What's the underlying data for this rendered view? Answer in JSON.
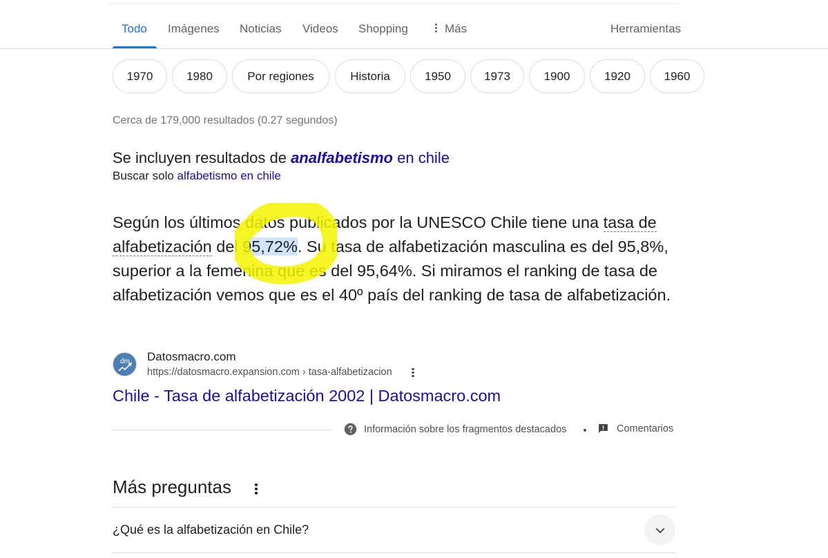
{
  "tabs": {
    "todo": "Todo",
    "imagenes": "Imágenes",
    "noticias": "Noticias",
    "videos": "Videos",
    "shopping": "Shopping",
    "mas": "Más",
    "herramientas": "Herramientas"
  },
  "chips": [
    "1970",
    "1980",
    "Por regiones",
    "Historia",
    "1950",
    "1973",
    "1900",
    "1920",
    "1960"
  ],
  "result_stats": "Cerca de 179,000 resultados (0.27 segundos)",
  "spelling": {
    "prefix": "Se incluyen resultados de ",
    "corrected_term": "analfabetismo",
    "corrected_suffix": " en chile",
    "search_only_prefix": "Buscar solo ",
    "search_only_link": "alfabetismo en chile"
  },
  "snippet": {
    "part1": "Según los últimos datos publicados por la UNESCO Chile tiene una ",
    "term": "tasa de alfabetización",
    "part2": " del ",
    "highlight": "95,72%",
    "part3": ". Su tasa de alfabetización masculina es del 95,8%, superior a la femenina que es del 95,64%. Si miramos el ranking de tasa de alfabetización vemos que es el 40º país del ranking de tasa de alfabetización."
  },
  "source": {
    "favicon_text": "dm",
    "site_name": "Datosmacro.com",
    "url": "https://datosmacro.expansion.com › tasa-alfabetizacion",
    "title": "Chile - Tasa de alfabetización 2002 | Datosmacro.com"
  },
  "footer": {
    "info": "Información sobre los fragmentos destacados",
    "feedback": "Comentarios"
  },
  "more_questions": {
    "title": "Más preguntas",
    "items": [
      "¿Qué es la alfabetización en Chile?"
    ]
  },
  "colors": {
    "accent": "#1a73e8",
    "link": "#1a0dab",
    "highlighter": "#f5f500",
    "selection": "#d2e3fc"
  },
  "icons": {
    "help": "help-circle-icon",
    "feedback": "feedback-icon",
    "expand": "chevron-down-icon",
    "more": "more-vert-icon"
  }
}
